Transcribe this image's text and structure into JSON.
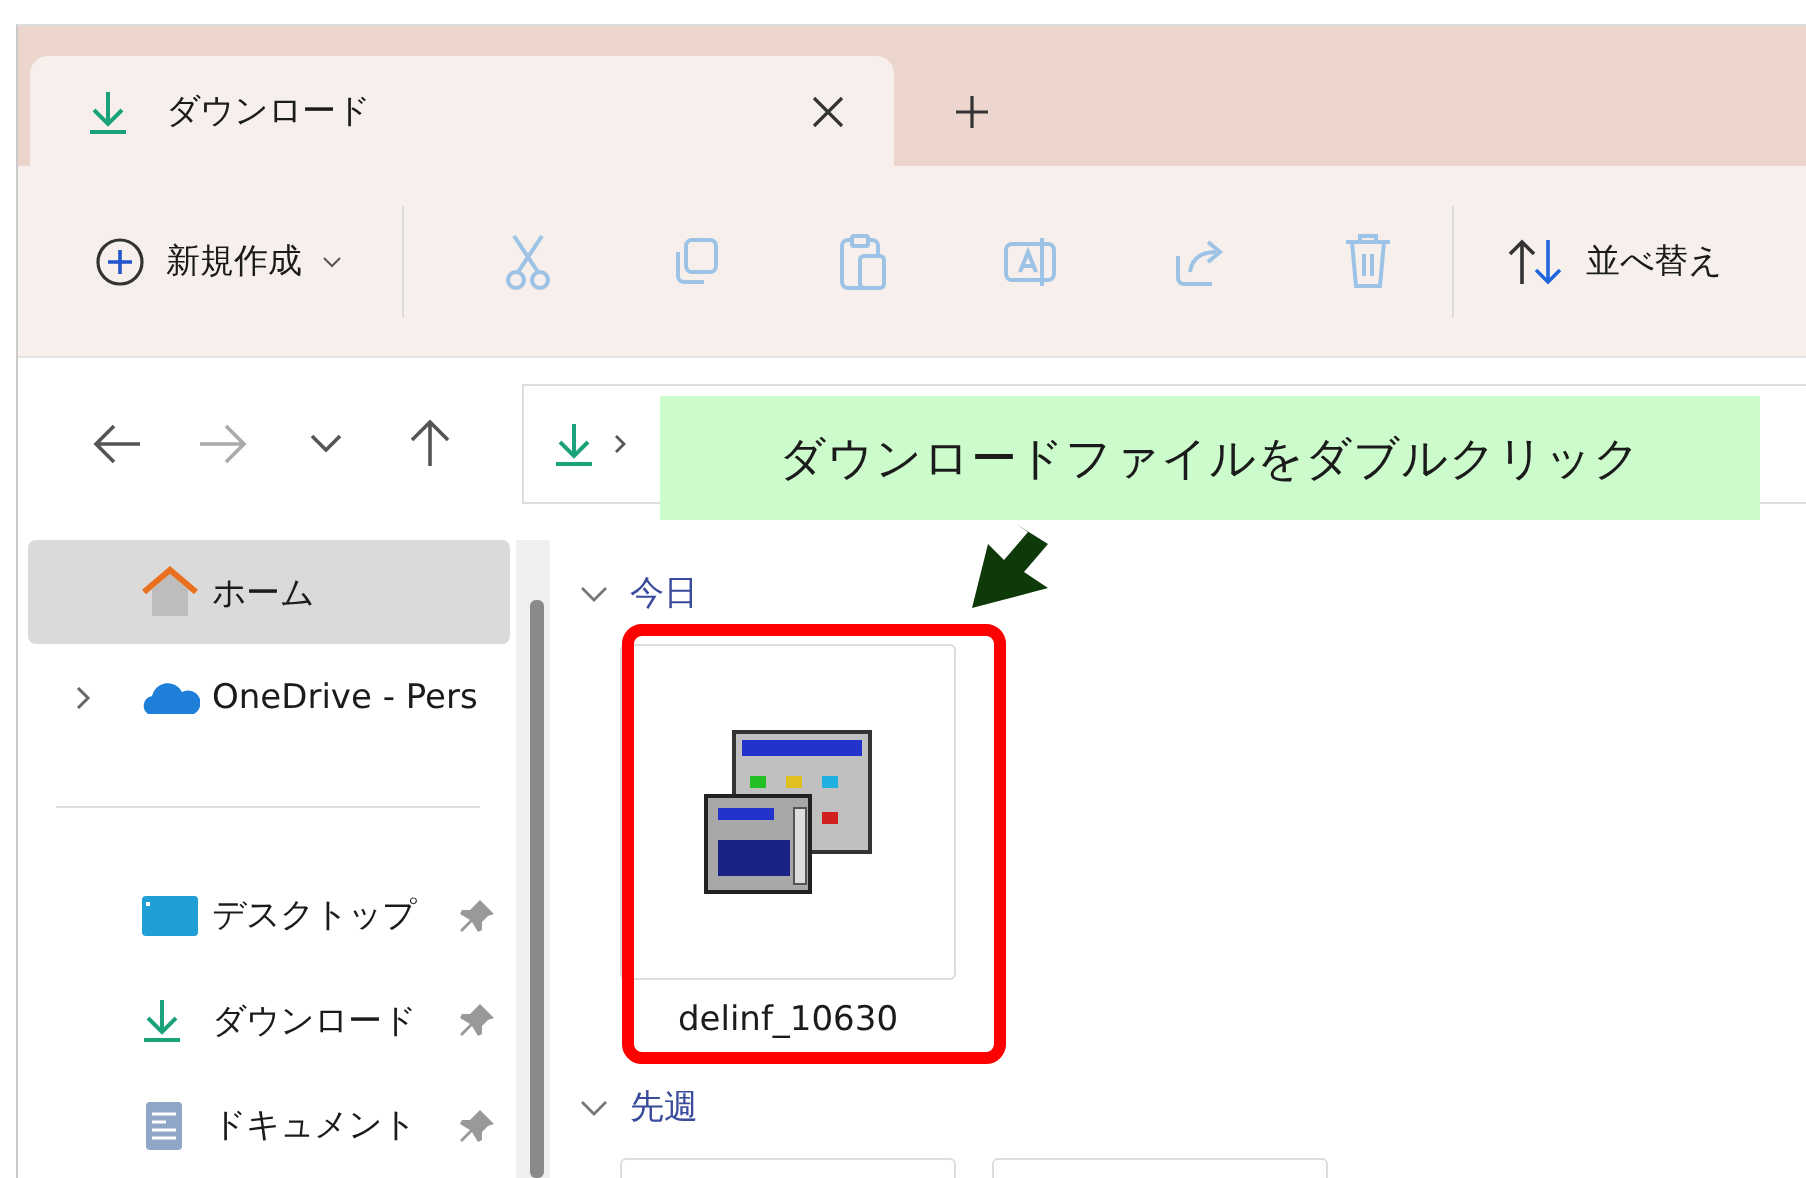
{
  "tab": {
    "title": "ダウンロード",
    "selected": true
  },
  "toolbar": {
    "new_label": "新規作成",
    "actions": [
      {
        "kind": "cut",
        "disabled": true
      },
      {
        "kind": "copy",
        "disabled": true
      },
      {
        "kind": "paste",
        "disabled": true
      },
      {
        "kind": "rename",
        "disabled": true
      },
      {
        "kind": "share",
        "disabled": true
      },
      {
        "kind": "delete",
        "disabled": true
      }
    ],
    "sort_label": "並べ替え"
  },
  "nav": {
    "back_disabled": false,
    "forward_disabled": true
  },
  "sidebar": {
    "items": [
      {
        "label": "ホーム",
        "kind": "home",
        "selected": true
      },
      {
        "label": "OneDrive - Pers",
        "kind": "cloud",
        "selected": false
      }
    ],
    "pinned": [
      {
        "label": "デスクトップ",
        "kind": "desktop",
        "selected": false,
        "pinned": true
      },
      {
        "label": "ダウンロード",
        "kind": "download",
        "selected": false,
        "pinned": true
      },
      {
        "label": "ドキュメント",
        "kind": "document",
        "selected": false,
        "pinned": true
      }
    ]
  },
  "groups": [
    {
      "label": "今日",
      "expanded": true,
      "files": [
        {
          "name": "delinf_10630",
          "kind": "zip"
        }
      ]
    },
    {
      "label": "先週",
      "expanded": true,
      "files": [
        {
          "kind": "blank"
        },
        {
          "kind": "blank"
        }
      ]
    }
  ],
  "callout": {
    "text": "ダウンロードファイルをダブルクリック"
  }
}
